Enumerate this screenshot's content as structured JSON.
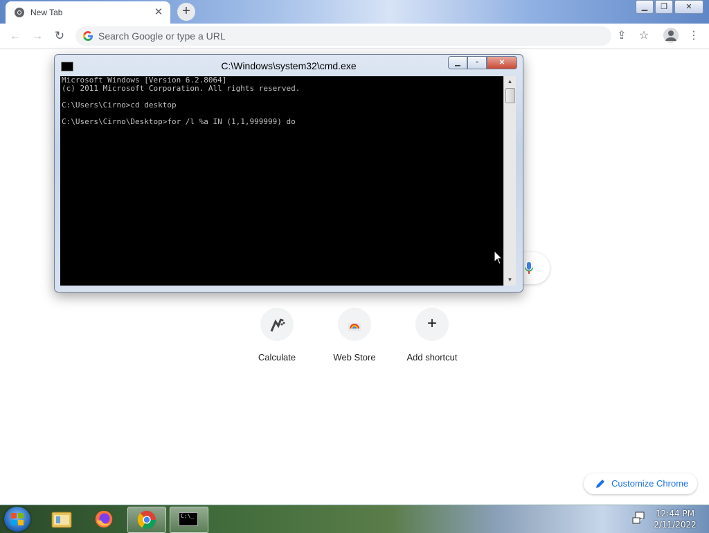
{
  "browser": {
    "tab_title": "New Tab",
    "tab_close": "✕",
    "new_tab": "+",
    "window_controls": {
      "minimize": "▁",
      "maximize": "❐",
      "close": "✕"
    },
    "nav": {
      "back": "←",
      "forward": "→",
      "reload": "↻"
    },
    "omnibox_placeholder": "Search Google or type a URL",
    "toolbar_right": {
      "share": "⇪",
      "bookmark": "☆",
      "menu": "⋮"
    }
  },
  "ntp": {
    "shortcuts": [
      {
        "label": "Calculate",
        "icon": "calculate-favicon-icon"
      },
      {
        "label": "Web Store",
        "icon": "web-store-icon"
      },
      {
        "label": "Add shortcut",
        "icon": "plus-icon",
        "symbol": "+"
      }
    ],
    "customize_label": "Customize Chrome"
  },
  "cmd": {
    "title": "C:\\Windows\\system32\\cmd.exe",
    "controls": {
      "minimize": "▁",
      "maximize": "▫",
      "close": "✕"
    },
    "lines": [
      "Microsoft Windows [Version 6.2.8064]",
      "(c) 2011 Microsoft Corporation. All rights reserved.",
      "",
      "C:\\Users\\Cirno>cd desktop",
      "",
      "C:\\Users\\Cirno\\Desktop>for /l %a IN (1,1,999999) do"
    ],
    "scroll_up": "▲",
    "scroll_down": "▼"
  },
  "taskbar": {
    "apps": [
      "file-explorer-icon",
      "firefox-icon",
      "chrome-icon",
      "cmd-icon"
    ],
    "cmd_icon_text": "C:\\_",
    "clock_time": "12:44 PM",
    "clock_date": "2/11/2022"
  },
  "colors": {
    "console_bg": "#000000",
    "console_text": "#c0c0c0",
    "link_blue": "#1a73e8",
    "close_red": "#c94a36"
  }
}
